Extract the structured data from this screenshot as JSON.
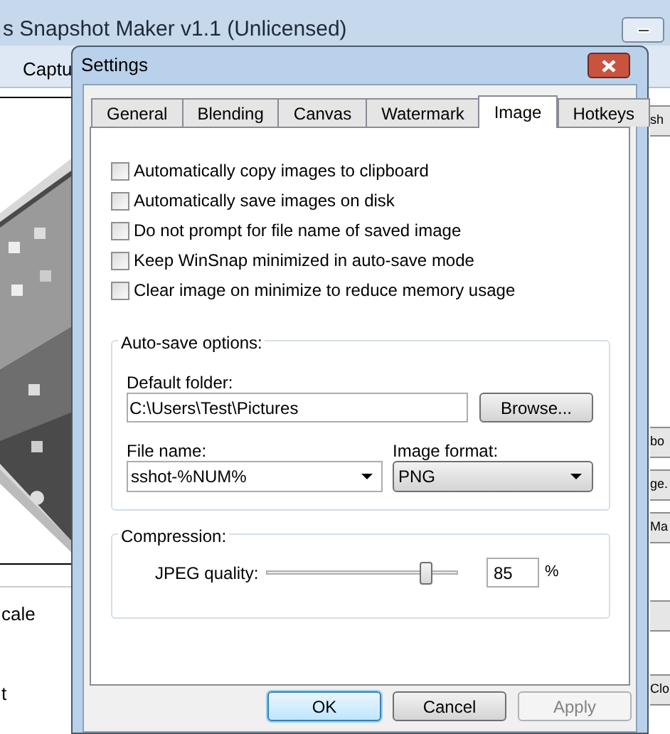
{
  "background_window": {
    "title": "s Snapshot Maker v1.1 (Unlicensed)",
    "menu": [
      "Captu"
    ],
    "preview": {
      "kind": "picture"
    },
    "list_items": [
      "cale",
      "t"
    ],
    "side_buttons": [
      "sh",
      "bo",
      "ge.",
      "Ma",
      "Clo"
    ]
  },
  "dialog": {
    "title": "Settings",
    "tabs": [
      {
        "label": "General",
        "selected": false
      },
      {
        "label": "Blending",
        "selected": false
      },
      {
        "label": "Canvas",
        "selected": false
      },
      {
        "label": "Watermark",
        "selected": false
      },
      {
        "label": "Image",
        "selected": true
      },
      {
        "label": "Hotkeys",
        "selected": false
      }
    ],
    "checkboxes": [
      {
        "label": "Automatically copy images to clipboard",
        "checked": false
      },
      {
        "label": "Automatically save images on disk",
        "checked": false
      },
      {
        "label": "Do not prompt for file name of saved image",
        "checked": false
      },
      {
        "label": "Keep WinSnap minimized in auto-save mode",
        "checked": false
      },
      {
        "label": "Clear image on minimize to reduce memory usage",
        "checked": false
      }
    ],
    "auto_save": {
      "title": "Auto-save options:",
      "default_folder": {
        "label": "Default folder:",
        "value": "C:\\Users\\Test\\Pictures"
      },
      "browse_button": "Browse...",
      "file_name": {
        "label": "File name:",
        "value": "sshot-%NUM%"
      },
      "image_format": {
        "label": "Image format:",
        "value": "PNG"
      }
    },
    "compression": {
      "title": "Compression:",
      "jpeg_quality": {
        "label": "JPEG quality:",
        "level": 0.83,
        "value": "85",
        "unit": "%"
      }
    },
    "buttons": [
      {
        "label": "OK",
        "focused": true,
        "disabled": false
      },
      {
        "label": "Cancel",
        "focused": false,
        "disabled": false
      },
      {
        "label": "Apply",
        "focused": false,
        "disabled": true
      }
    ]
  }
}
